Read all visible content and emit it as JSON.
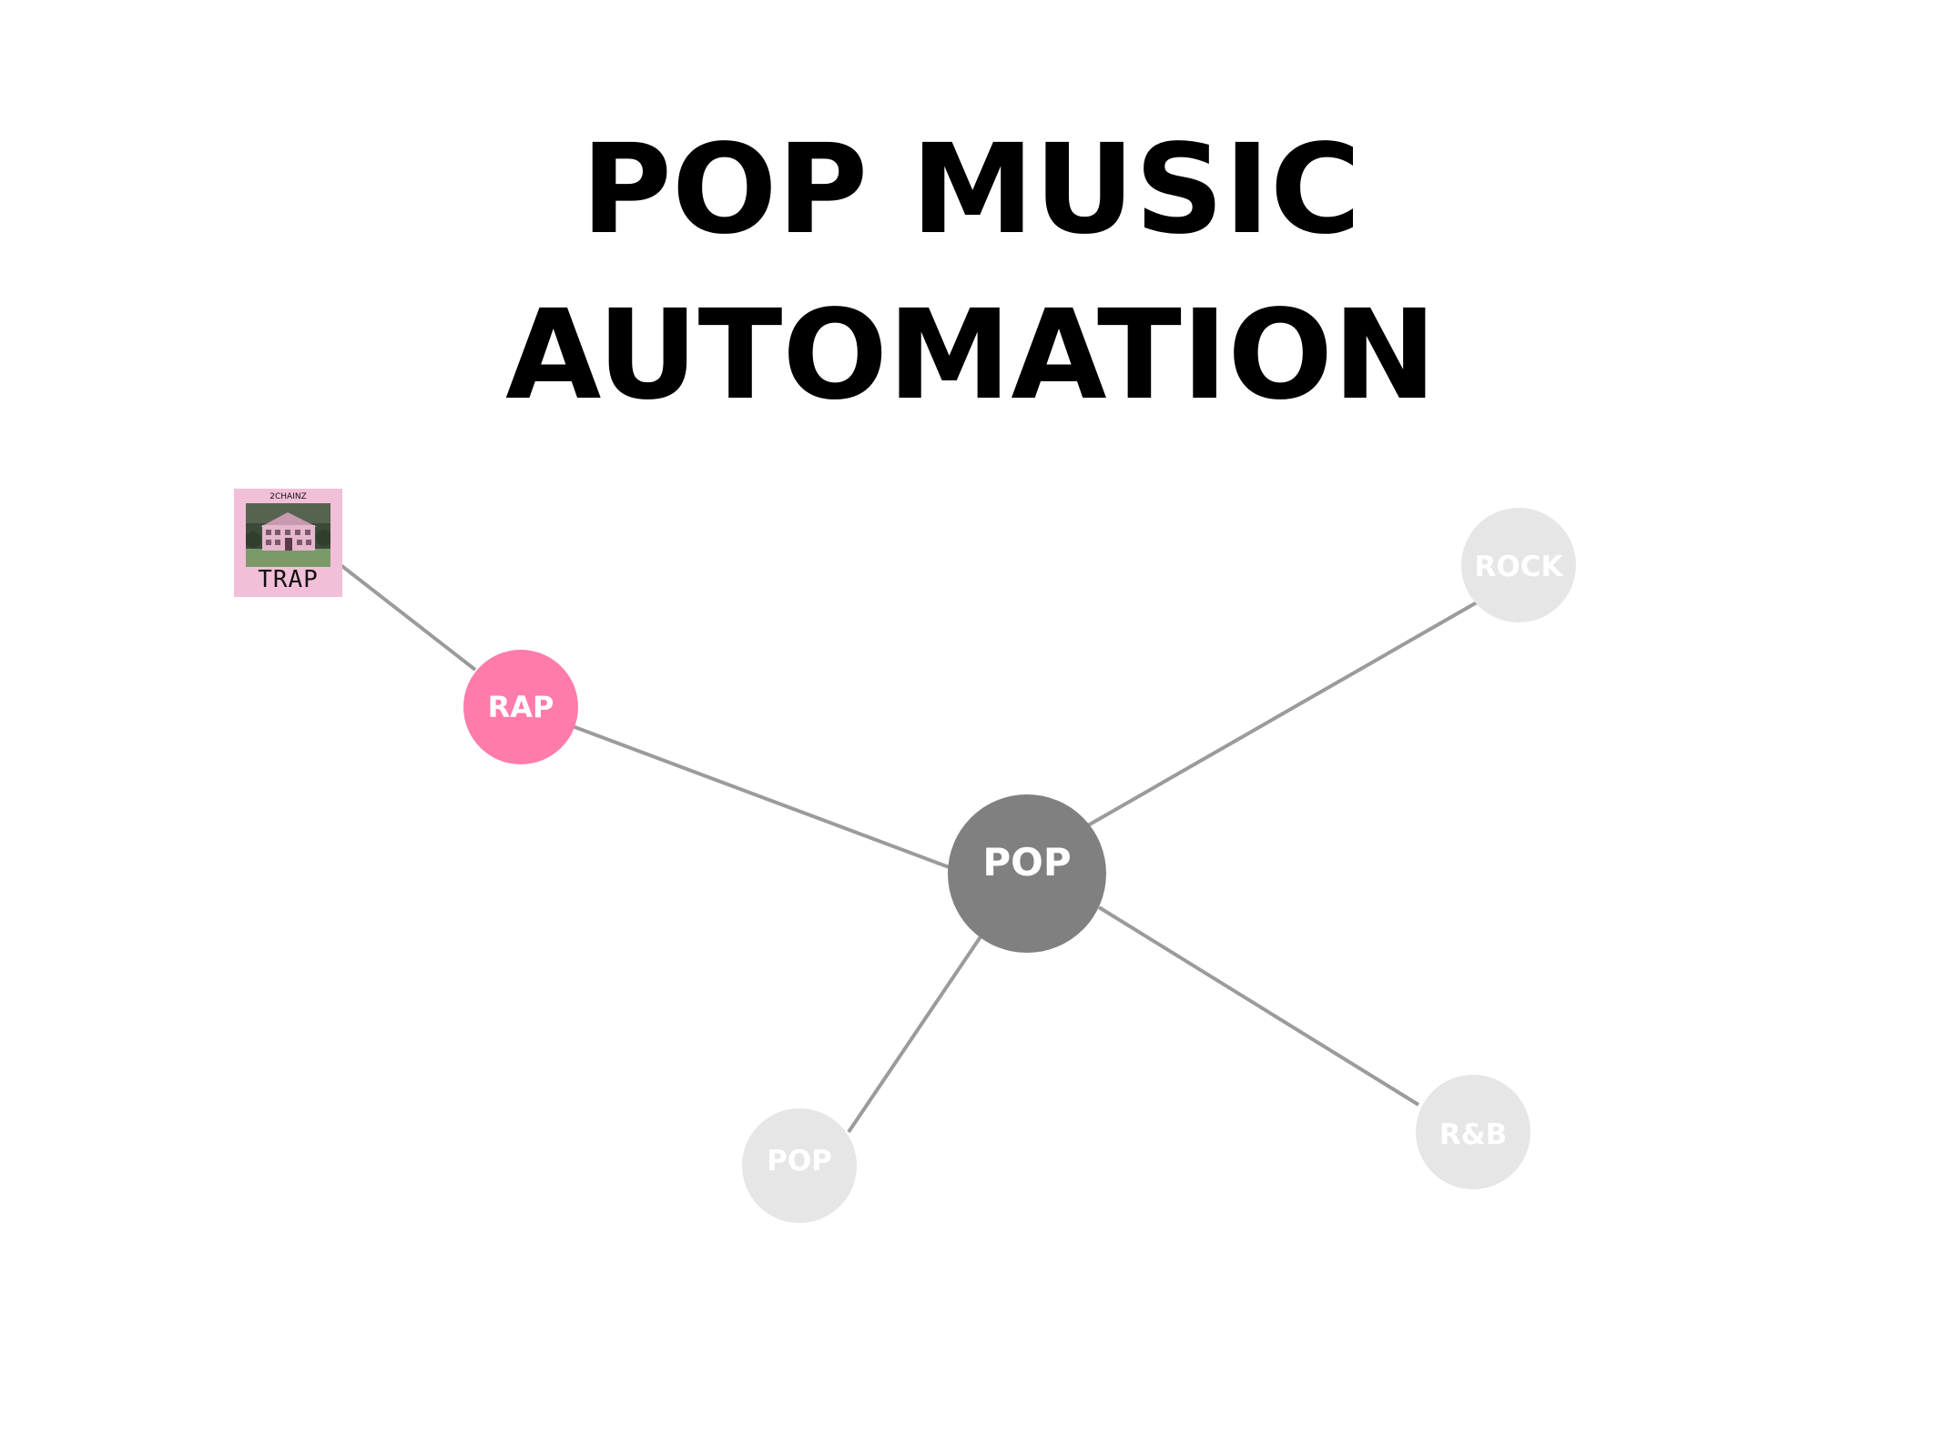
{
  "title": {
    "line1": "POP MUSIC",
    "line2": "AUTOMATION"
  },
  "album": {
    "artist": "2CHAINZ",
    "name": "TRAP",
    "background": "#f2bfd8"
  },
  "colors": {
    "edge": "#9b9b9b",
    "rap_node": "#ff7bac",
    "pop_center_node": "#808080",
    "inactive_node": "#e6e6e6",
    "node_text": "#ffffff"
  },
  "graph": {
    "nodes": [
      {
        "id": "album",
        "label": ""
      },
      {
        "id": "rap",
        "label": "RAP",
        "state": "selected"
      },
      {
        "id": "pop-center",
        "label": "POP",
        "state": "current"
      },
      {
        "id": "rock",
        "label": "ROCK",
        "state": "inactive"
      },
      {
        "id": "pop-leaf",
        "label": "POP",
        "state": "inactive"
      },
      {
        "id": "rnb",
        "label": "R&B",
        "state": "inactive"
      }
    ],
    "edges": [
      [
        "album",
        "rap"
      ],
      [
        "rap",
        "pop-center"
      ],
      [
        "pop-center",
        "rock"
      ],
      [
        "pop-center",
        "pop-leaf"
      ],
      [
        "pop-center",
        "rnb"
      ]
    ]
  }
}
